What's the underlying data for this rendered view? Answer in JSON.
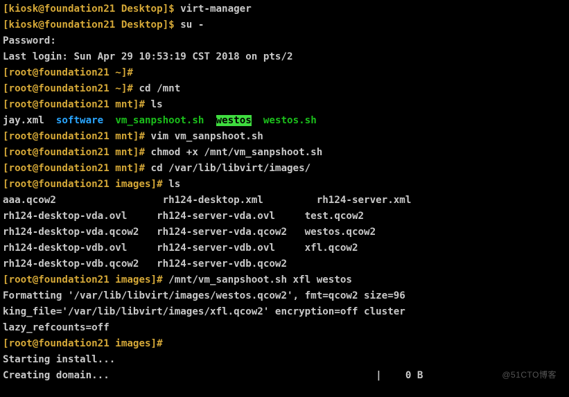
{
  "lines": {
    "l0": {
      "prompt": "[kiosk@foundation21 Desktop]$ ",
      "cmd": "virt-manager"
    },
    "l1": {
      "prompt": "[kiosk@foundation21 Desktop]$ ",
      "cmd": "su -"
    },
    "l2": "Password:",
    "l3": "Last login: Sun Apr 29 10:53:19 CST 2018 on pts/2",
    "l4": {
      "prompt": "[root@foundation21 ~]#",
      "cmd": ""
    },
    "l5": {
      "prompt": "[root@foundation21 ~]# ",
      "cmd": "cd /mnt"
    },
    "l6": {
      "prompt": "[root@foundation21 mnt]# ",
      "cmd": "ls"
    },
    "l7": {
      "a": "jay.xml  ",
      "b": "software",
      "sp1": "  ",
      "c": "vm_sanpshoot.sh",
      "sp2": "  ",
      "d": "westos",
      "sp3": "  ",
      "e": "westos.sh"
    },
    "l8": {
      "prompt": "[root@foundation21 mnt]# ",
      "cmd": "vim vm_sanpshoot.sh"
    },
    "l9": {
      "prompt": "[root@foundation21 mnt]# ",
      "cmd": "chmod +x /mnt/vm_sanpshoot.sh"
    },
    "l10": {
      "prompt": "[root@foundation21 mnt]# ",
      "cmd": "cd /var/lib/libvirt/images/"
    },
    "l11": {
      "prompt": "[root@foundation21 images]# ",
      "cmd": "ls"
    },
    "l12": {
      "a": "aaa.qcow2                  ",
      "b": "rh124-desktop.xml         ",
      "c": "rh124-server.xml"
    },
    "l13": {
      "a": "rh124-desktop-vda.ovl     ",
      "b": "rh124-server-vda.ovl     ",
      "c": "test.qcow2"
    },
    "l14": {
      "a": "rh124-desktop-vda.qcow2   ",
      "b": "rh124-server-vda.qcow2   ",
      "c": "westos.qcow2"
    },
    "l15": {
      "a": "rh124-desktop-vdb.ovl     ",
      "b": "rh124-server-vdb.ovl     ",
      "c": "xfl.qcow2"
    },
    "l16": {
      "a": "rh124-desktop-vdb.qcow2   ",
      "b": "rh124-server-vdb.qcow2"
    },
    "l17": {
      "prompt": "[root@foundation21 images]# ",
      "cmd": "/mnt/vm_sanpshoot.sh xfl westos"
    },
    "l18": "Formatting '/var/lib/libvirt/images/westos.qcow2', fmt=qcow2 size=96",
    "l19": "king_file='/var/lib/libvirt/images/xfl.qcow2' encryption=off cluster",
    "l20": "lazy_refcounts=off",
    "l21": {
      "prompt": "[root@foundation21 images]#",
      "cmd": ""
    },
    "l22": "Starting install...",
    "l23": "Creating domain...                                             |    0 B "
  },
  "watermark": "@51CTO博客"
}
